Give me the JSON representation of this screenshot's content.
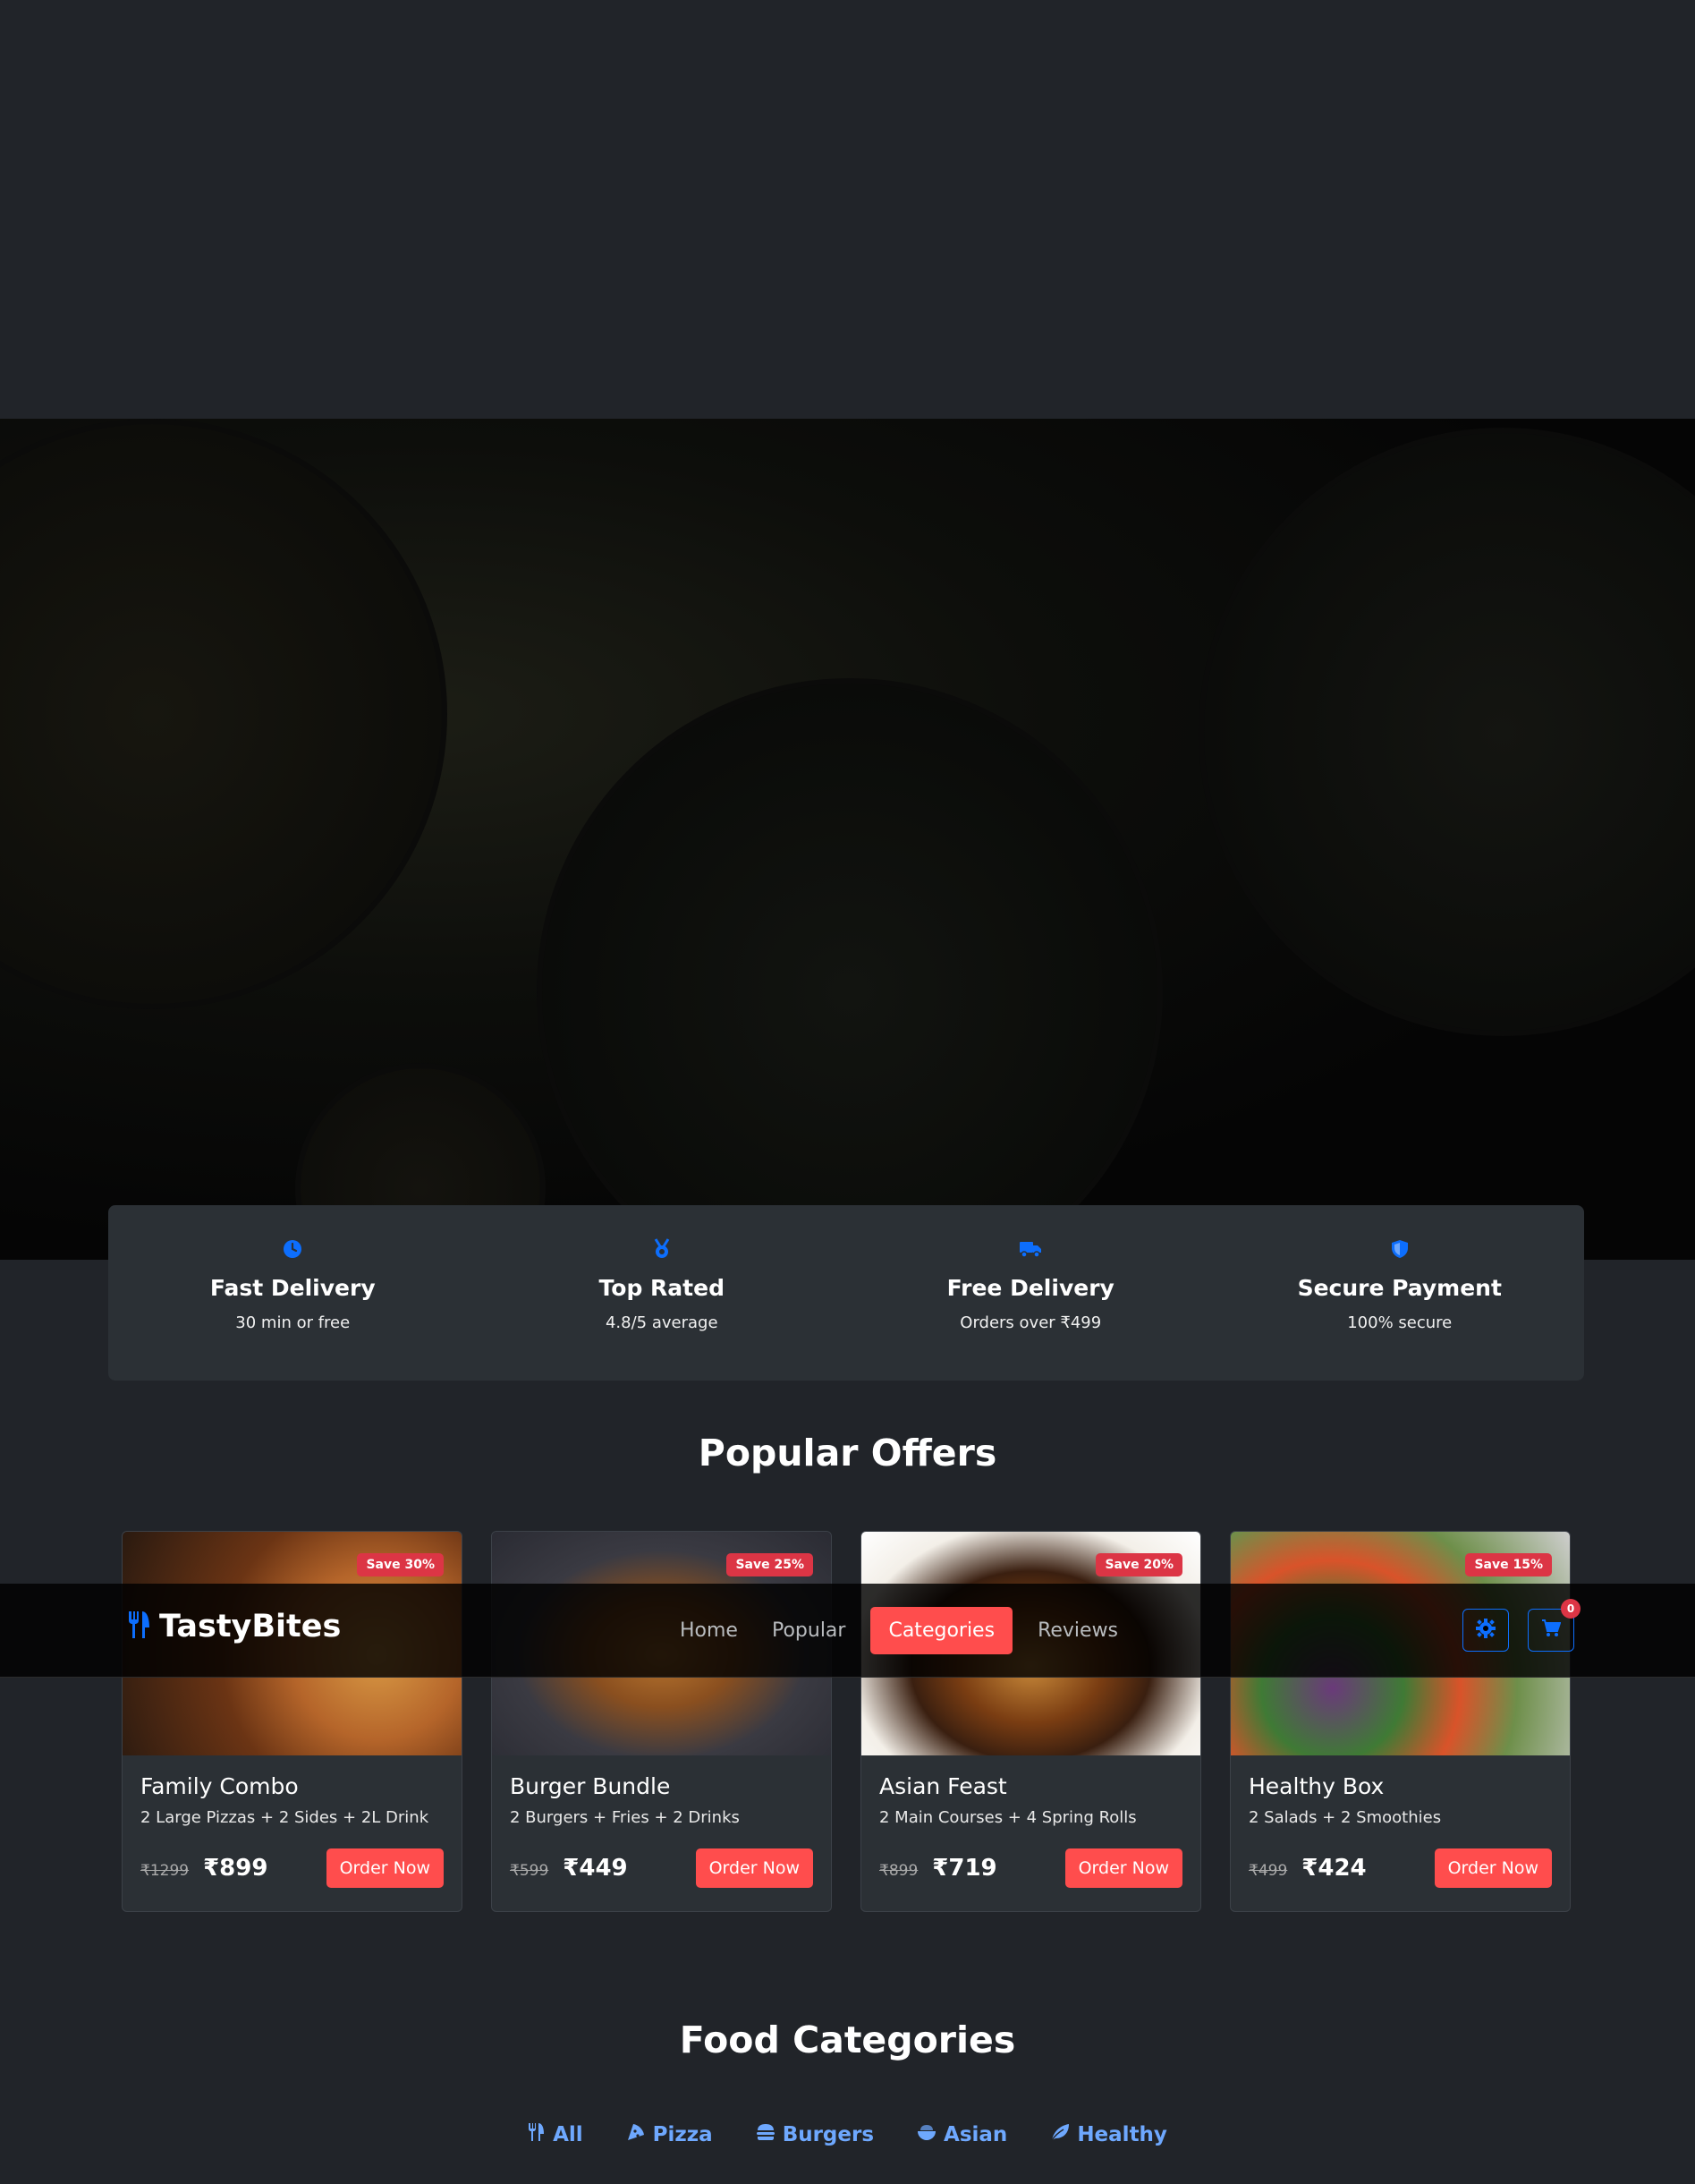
{
  "brand": {
    "name": "TastyBites",
    "icon": "utensils-icon"
  },
  "nav": {
    "links": [
      "Home",
      "Popular",
      "Categories",
      "Reviews"
    ],
    "active": "Categories",
    "cart_count": "0"
  },
  "features": [
    {
      "icon": "clock-icon",
      "title": "Fast Delivery",
      "subtitle": "30 min or free"
    },
    {
      "icon": "medal-icon",
      "title": "Top Rated",
      "subtitle": "4.8/5 average"
    },
    {
      "icon": "truck-icon",
      "title": "Free Delivery",
      "subtitle": "Orders over ₹499"
    },
    {
      "icon": "shield-icon",
      "title": "Secure Payment",
      "subtitle": "100% secure"
    }
  ],
  "offers": {
    "title": "Popular Offers",
    "items": [
      {
        "name": "Family Combo",
        "desc": "2 Large Pizzas + 2 Sides + 2L Drink",
        "old_price": "₹1299",
        "price": "₹899",
        "badge": "Save 30%",
        "button": "Order Now"
      },
      {
        "name": "Burger Bundle",
        "desc": "2 Burgers + Fries + 2 Drinks",
        "old_price": "₹599",
        "price": "₹449",
        "badge": "Save 25%",
        "button": "Order Now"
      },
      {
        "name": "Asian Feast",
        "desc": "2 Main Courses + 4 Spring Rolls",
        "old_price": "₹899",
        "price": "₹719",
        "badge": "Save 20%",
        "button": "Order Now"
      },
      {
        "name": "Healthy Box",
        "desc": "2 Salads + 2 Smoothies",
        "old_price": "₹499",
        "price": "₹424",
        "badge": "Save 15%",
        "button": "Order Now"
      }
    ]
  },
  "categories": {
    "title": "Food Categories",
    "tabs": [
      {
        "label": "All",
        "icon": "utensils-icon"
      },
      {
        "label": "Pizza",
        "icon": "pizza-icon"
      },
      {
        "label": "Burgers",
        "icon": "burger-icon"
      },
      {
        "label": "Asian",
        "icon": "bowl-icon"
      },
      {
        "label": "Healthy",
        "icon": "leaf-icon"
      }
    ]
  },
  "colors": {
    "accent": "#ff4d4d",
    "primary": "#0d6efd",
    "link": "#6ea8fe",
    "background": "#212429",
    "card": "#2b3035"
  }
}
